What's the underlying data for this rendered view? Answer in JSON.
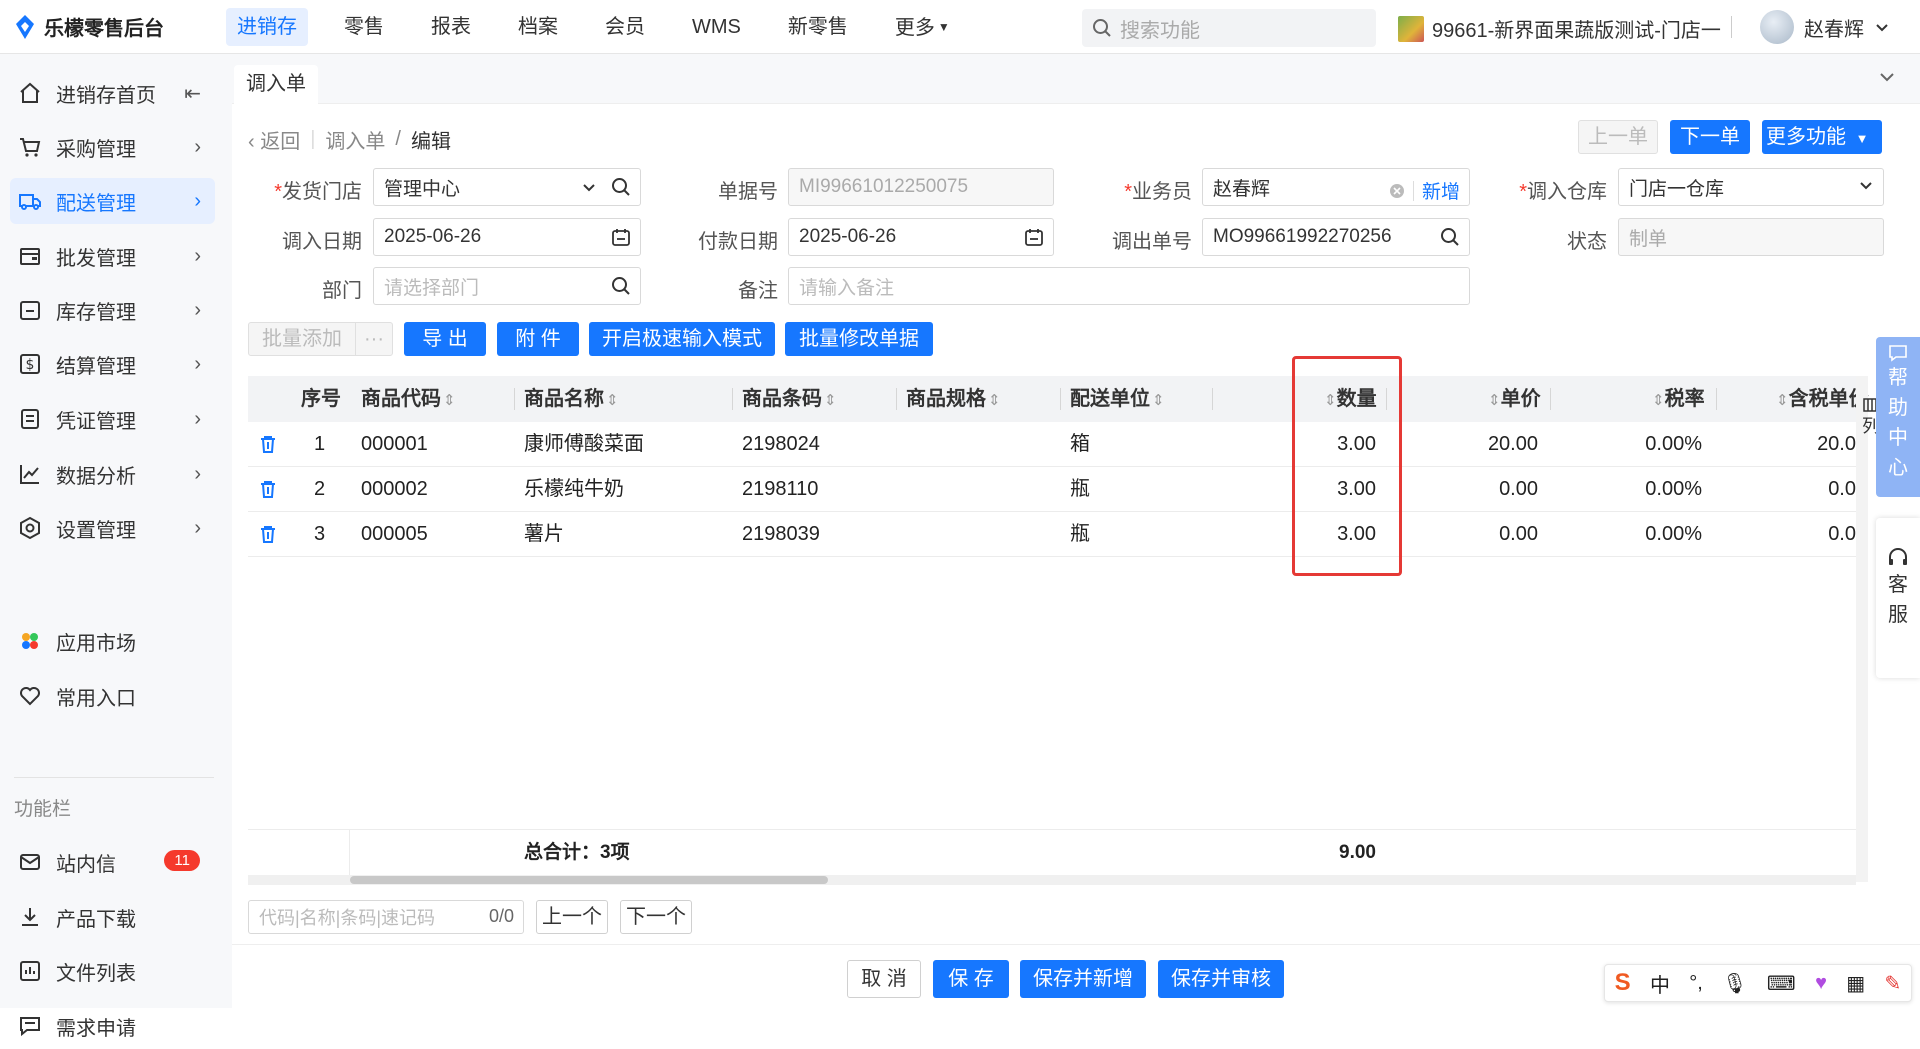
{
  "app": {
    "logo_text": "乐檬零售后台",
    "brand_color": "#1677ff"
  },
  "topnav": [
    "进销存",
    "零售",
    "报表",
    "档案",
    "会员",
    "WMS",
    "新零售",
    "更多"
  ],
  "search": {
    "placeholder": "搜索功能"
  },
  "store": {
    "name": "99661-新界面果蔬版测试-门店一"
  },
  "user": {
    "name": "赵春辉"
  },
  "sidebar": {
    "items": [
      {
        "label": "进销存首页",
        "icon": "home-icon"
      },
      {
        "label": "采购管理",
        "icon": "cart-icon"
      },
      {
        "label": "配送管理",
        "icon": "delivery-icon"
      },
      {
        "label": "批发管理",
        "icon": "wallet-icon"
      },
      {
        "label": "库存管理",
        "icon": "inventory-icon"
      },
      {
        "label": "结算管理",
        "icon": "dollar-icon"
      },
      {
        "label": "凭证管理",
        "icon": "voucher-icon"
      },
      {
        "label": "数据分析",
        "icon": "chart-icon"
      },
      {
        "label": "设置管理",
        "icon": "settings-icon"
      }
    ],
    "extra": [
      {
        "label": "应用市场",
        "icon": "app-market-icon"
      },
      {
        "label": "常用入口",
        "icon": "heart-icon"
      }
    ],
    "section_title": "功能栏",
    "func": [
      {
        "label": "站内信",
        "icon": "mail-icon",
        "badge": "11"
      },
      {
        "label": "产品下载",
        "icon": "download-icon"
      },
      {
        "label": "文件列表",
        "icon": "file-list-icon"
      },
      {
        "label": "需求申请",
        "icon": "request-icon"
      }
    ]
  },
  "tab": {
    "label": "调入单"
  },
  "breadcrumb": {
    "back": "返回",
    "parent": "调入单",
    "sep": "/",
    "current": "编辑"
  },
  "actions": {
    "prev": "上一单",
    "next": "下一单",
    "more": "更多功能"
  },
  "form": {
    "send_store": {
      "label": "发货门店",
      "value": "管理中心"
    },
    "doc_no": {
      "label": "单据号",
      "value": "MI99661012250075"
    },
    "salesman": {
      "label": "业务员",
      "value": "赵春辉",
      "add": "新增"
    },
    "in_warehouse": {
      "label": "调入仓库",
      "value": "门店一仓库"
    },
    "in_date": {
      "label": "调入日期",
      "value": "2025-06-26"
    },
    "pay_date": {
      "label": "付款日期",
      "value": "2025-06-26"
    },
    "out_no": {
      "label": "调出单号",
      "value": "MO99661992270256"
    },
    "status": {
      "label": "状态",
      "value": "制单"
    },
    "dept": {
      "label": "部门",
      "placeholder": "请选择部门"
    },
    "remark": {
      "label": "备注",
      "placeholder": "请输入备注"
    }
  },
  "toolbar": {
    "batch_add": "批量添加",
    "more": "···",
    "export": "导 出",
    "attach": "附 件",
    "fast_mode": "开启极速输入模式",
    "batch_edit": "批量修改单据"
  },
  "table": {
    "columns": [
      "序号",
      "商品代码",
      "商品名称",
      "商品条码",
      "商品规格",
      "配送单位",
      "数量",
      "单价",
      "税率",
      "含税单价"
    ],
    "rows": [
      {
        "seq": "1",
        "code": "000001",
        "name": "康师傅酸菜面",
        "barcode": "2198024",
        "spec": "",
        "unit": "箱",
        "qty": "3.00",
        "price": "20.00",
        "tax": "0.00%",
        "tax_price": "20.0"
      },
      {
        "seq": "2",
        "code": "000002",
        "name": "乐檬纯牛奶",
        "barcode": "2198110",
        "spec": "",
        "unit": "瓶",
        "qty": "3.00",
        "price": "0.00",
        "tax": "0.00%",
        "tax_price": "0.0"
      },
      {
        "seq": "3",
        "code": "000005",
        "name": "薯片",
        "barcode": "2198039",
        "spec": "",
        "unit": "瓶",
        "qty": "3.00",
        "price": "0.00",
        "tax": "0.00%",
        "tax_price": "0.0"
      }
    ],
    "total_label": "总合计：3项",
    "total_qty": "9.00",
    "column_setting": "列"
  },
  "locator": {
    "placeholder": "代码|名称|条码|速记码",
    "count": "0/0",
    "prev": "上一个",
    "next": "下一个"
  },
  "footer": {
    "cancel": "取 消",
    "save": "保 存",
    "save_new": "保存并新增",
    "save_audit": "保存并审核"
  },
  "float": {
    "help": [
      "帮",
      "助",
      "中",
      "心"
    ],
    "service": [
      "客",
      "服"
    ]
  },
  "ime": {
    "lang": "中",
    "punct": "°,"
  }
}
